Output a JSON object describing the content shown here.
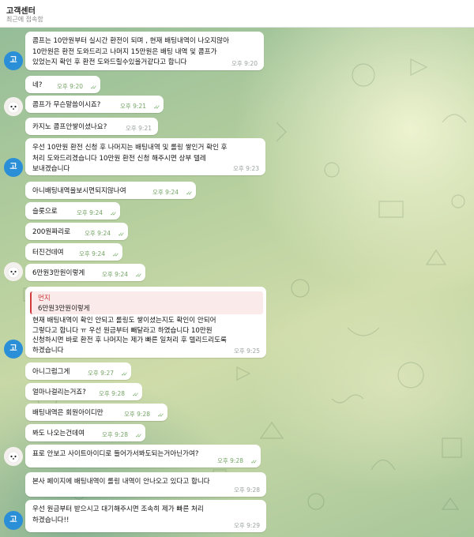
{
  "header": {
    "title": "고객센터",
    "subtitle": "최근에 접속함"
  },
  "avatars": {
    "manager_initial": "고"
  },
  "messages": [
    {
      "text": "콤프는 10만원부터 실시간 환전이 되며 , 현재 배팅내역이 나오지않아\n10만원은 환전 도와드리고 나머지 15만원은 배팅 내역 및 콤프가\n있었는지 확인 후 환전 도와드릴수있을거같다고 합니다",
      "time": "오후 9:20"
    },
    {
      "text": "네?",
      "time": "오후 9:20"
    },
    {
      "text": "콤프가 무슨말씀이시죠?",
      "time": "오후 9:21"
    },
    {
      "text": "카지노 콤프안쌓이셨나요?",
      "time": "오후 9:21"
    },
    {
      "text": "우선 10만원 환전 신청 후 나머지는 배팅내역 및 롤링 쌓인거 확인 후\n처리 도와드리겠습니다 10만원 환전 신청 해주시면 상부 텔레\n보내겠습니다",
      "time": "오후 9:23"
    },
    {
      "text": "아니배팅내역을보시면되지않나여",
      "time": "오후 9:24"
    },
    {
      "text": "슬롯으로",
      "time": "오후 9:24"
    },
    {
      "text": "200원짜리로",
      "time": "오후 9:24"
    },
    {
      "text": "터진건데여",
      "time": "오후 9:24"
    },
    {
      "text": "6만원3만원이렇게",
      "time": "오후 9:24"
    },
    {
      "reply_name": "먼지",
      "reply_text": "6만원3만원이렇게",
      "text": "현재 배팅내역이 확인 안되고 롤링도 쌓이셨는지도 확인이 안되어\n그렇다고 합니다 ㅠ 우선 원금부터 빼달라고 하였습니다 10만원\n신청하시면 바로 환전 후 나머지는 제가 빠른 일처리 후 텔리드리도록\n하겠습니다",
      "time": "오후 9:25"
    },
    {
      "text": "아니그럼그게",
      "time": "오후 9:27"
    },
    {
      "text": "얼마나걸리는거죠?",
      "time": "오후 9:28"
    },
    {
      "text": "배팅내역은 회원아이디만",
      "time": "오후 9:28"
    },
    {
      "text": "봐도 나오는건데여",
      "time": "오후 9:28"
    },
    {
      "text": "표로 안보고 사이트아이디로 들어가서봐도되는거아닌가여?",
      "time": "오후 9:28"
    },
    {
      "text": "본사 페이지에 배팅내역이 롤링 내역이 안나오고 있다고 합니다",
      "time": "오후 9:28"
    },
    {
      "text": "우선 원금부터 받으시고 대기해주시면 조속히 제가 빠른 처리\n하겠습니다!!",
      "time": "오후 9:29"
    }
  ]
}
